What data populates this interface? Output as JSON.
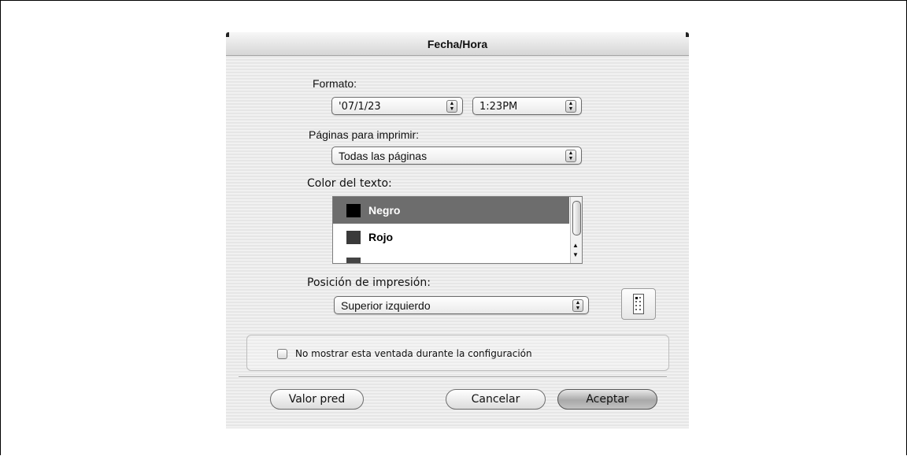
{
  "dialog": {
    "title": "Fecha/Hora"
  },
  "format": {
    "label": "Formato:",
    "date_value": "'07/1/23",
    "time_value": "1:23PM"
  },
  "pages": {
    "label": "Páginas para imprimir:",
    "value": "Todas las páginas"
  },
  "text_color": {
    "label": "Color del texto:",
    "items": [
      {
        "label": "Negro",
        "swatch": "#000000",
        "selected": true
      },
      {
        "label": "Rojo",
        "swatch": "#3a3a3a",
        "selected": false
      },
      {
        "label": "",
        "swatch": "#444444",
        "selected": false
      }
    ]
  },
  "position": {
    "label": "Posición de impresión:",
    "value": "Superior izquierdo",
    "layout_icon": "page-position-icon"
  },
  "options": {
    "dont_show_label": "No mostrar esta ventada durante la configuración",
    "dont_show_checked": false
  },
  "buttons": {
    "default_label": "Valor pred",
    "cancel_label": "Cancelar",
    "accept_label": "Aceptar"
  }
}
